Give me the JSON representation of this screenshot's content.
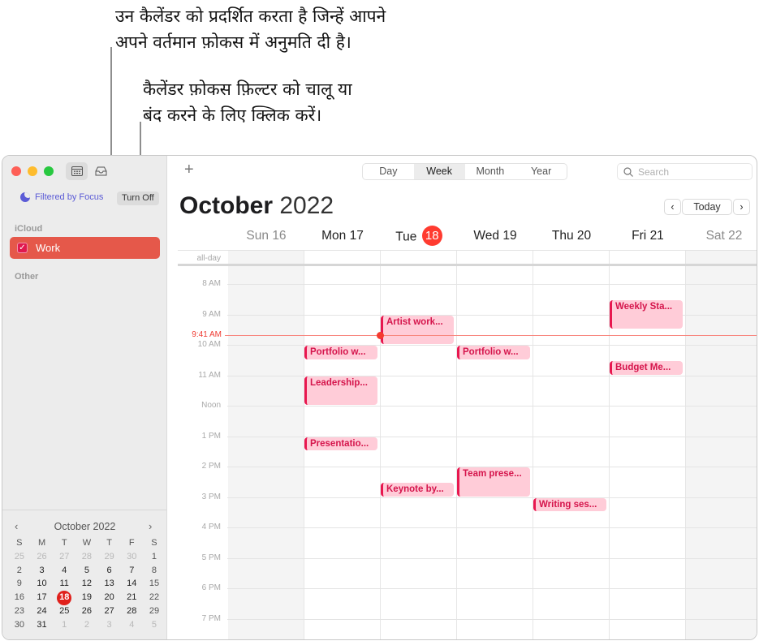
{
  "callouts": [
    {
      "text": "उन कैलेंडर को प्रदर्शित करता है जिन्हें आपने\nअपने वर्तमान फ़ोकस में अनुमति दी है।"
    },
    {
      "text": "कैलेंडर फ़ोकस फ़िल्टर को चालू या\nबंद करने के लिए क्लिक करें।"
    }
  ],
  "sidebar": {
    "focus_label": "Filtered by Focus",
    "turn_off_label": "Turn Off",
    "sections": [
      {
        "label": "iCloud",
        "calendars": [
          {
            "name": "Work",
            "checked": true,
            "color": "#e5584a"
          }
        ]
      },
      {
        "label": "Other",
        "calendars": []
      }
    ],
    "mini_calendar": {
      "title": "October 2022",
      "prev": "‹",
      "next": "›",
      "weekdays": [
        "S",
        "M",
        "T",
        "W",
        "T",
        "F",
        "S"
      ],
      "weeks": [
        [
          "25",
          "26",
          "27",
          "28",
          "29",
          "30",
          "1"
        ],
        [
          "2",
          "3",
          "4",
          "5",
          "6",
          "7",
          "8"
        ],
        [
          "9",
          "10",
          "11",
          "12",
          "13",
          "14",
          "15"
        ],
        [
          "16",
          "17",
          "18",
          "19",
          "20",
          "21",
          "22"
        ],
        [
          "23",
          "24",
          "25",
          "26",
          "27",
          "28",
          "29"
        ],
        [
          "30",
          "31",
          "1",
          "2",
          "3",
          "4",
          "5"
        ]
      ],
      "today": "18"
    }
  },
  "toolbar": {
    "add_label": "+",
    "views": [
      {
        "label": "Day",
        "active": false
      },
      {
        "label": "Week",
        "active": true
      },
      {
        "label": "Month",
        "active": false
      },
      {
        "label": "Year",
        "active": false
      }
    ],
    "search_placeholder": "Search"
  },
  "header": {
    "month": "October",
    "year": "2022",
    "prev": "‹",
    "today_label": "Today",
    "next": "›"
  },
  "week": {
    "days": [
      {
        "name": "Sun",
        "date": "16",
        "weekend": true,
        "today": false
      },
      {
        "name": "Mon",
        "date": "17",
        "weekend": false,
        "today": false
      },
      {
        "name": "Tue",
        "date": "18",
        "weekend": false,
        "today": true
      },
      {
        "name": "Wed",
        "date": "19",
        "weekend": false,
        "today": false
      },
      {
        "name": "Thu",
        "date": "20",
        "weekend": false,
        "today": false
      },
      {
        "name": "Fri",
        "date": "21",
        "weekend": false,
        "today": false
      },
      {
        "name": "Sat",
        "date": "22",
        "weekend": true,
        "today": false
      }
    ],
    "all_day_label": "all-day",
    "hours": [
      "8 AM",
      "9 AM",
      "10 AM",
      "11 AM",
      "Noon",
      "1 PM",
      "2 PM",
      "3 PM",
      "4 PM",
      "5 PM",
      "6 PM",
      "7 PM"
    ],
    "now_label": "9:41 AM",
    "now_time": 9.683,
    "event_color": "#e8174f",
    "events": [
      {
        "title": "Weekly Sta...",
        "day": 5,
        "start": 8.5,
        "end": 9.5
      },
      {
        "title": "Artist work...",
        "day": 2,
        "start": 9.0,
        "end": 10.0
      },
      {
        "title": "Portfolio w...",
        "day": 1,
        "start": 10.0,
        "end": 10.5
      },
      {
        "title": "Portfolio w...",
        "day": 3,
        "start": 10.0,
        "end": 10.5
      },
      {
        "title": "Budget Me...",
        "day": 5,
        "start": 10.5,
        "end": 11.0
      },
      {
        "title": "Leadership...",
        "day": 1,
        "start": 11.0,
        "end": 12.0
      },
      {
        "title": "Presentatio...",
        "day": 1,
        "start": 13.0,
        "end": 13.5
      },
      {
        "title": "Team prese...",
        "day": 3,
        "start": 14.0,
        "end": 15.0
      },
      {
        "title": "Keynote by...",
        "day": 2,
        "start": 14.5,
        "end": 15.0
      },
      {
        "title": "Writing ses...",
        "day": 4,
        "start": 15.0,
        "end": 15.5
      }
    ]
  }
}
